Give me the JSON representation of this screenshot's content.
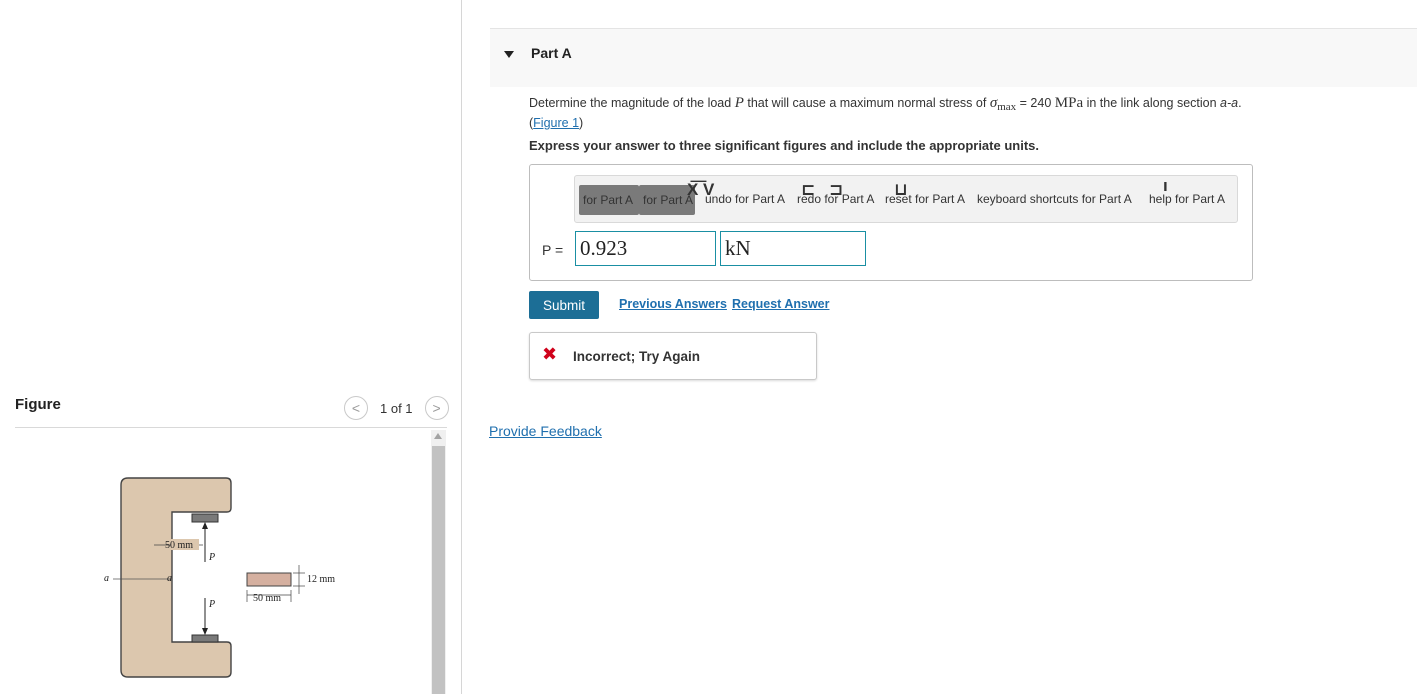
{
  "figure": {
    "title": "Figure",
    "nav": {
      "prev": "<",
      "count": "1 of 1",
      "next": ">"
    },
    "labels": {
      "a_left": "a",
      "a_inner": "a",
      "dim_50_top": "50 mm",
      "p_top": "P",
      "p_bottom": "P",
      "dim_12": "12 mm",
      "dim_50_bottom": "50 mm"
    }
  },
  "part": {
    "title": "Part A",
    "question": {
      "pre": "Determine the magnitude of the load",
      "var": "P",
      "mid": "that will cause a maximum normal stress of",
      "sigma": "σ",
      "sigma_sub": "max",
      "eq": "= 240",
      "unit": "MPa",
      "post": "in the link along section",
      "section": "a-a",
      "end": ".",
      "figure_link": "Figure 1"
    },
    "instruction": "Express your answer to three significant figures and include the appropriate units.",
    "toolbar": {
      "btn1": "for Part A",
      "btn2": "for Part A",
      "undo": "undo for Part A",
      "redo": "redo for Part A",
      "reset": "reset for Part A",
      "keyboard": "keyboard shortcuts for Part A",
      "help": "help for Part A"
    },
    "answer": {
      "label": "P =",
      "value": "0.923",
      "unit": "kN"
    },
    "submit": "Submit",
    "previous_answers": "Previous Answers",
    "request_answer": "Request Answer",
    "feedback": {
      "icon": "✖",
      "text": "Incorrect; Try Again"
    },
    "provide_feedback": "Provide Feedback"
  },
  "colors": {
    "accent": "#1c6e96",
    "link": "#1f6fae",
    "error": "#d0021b",
    "input_border": "#1a8fa3",
    "link_body": "#dcc7ae"
  }
}
